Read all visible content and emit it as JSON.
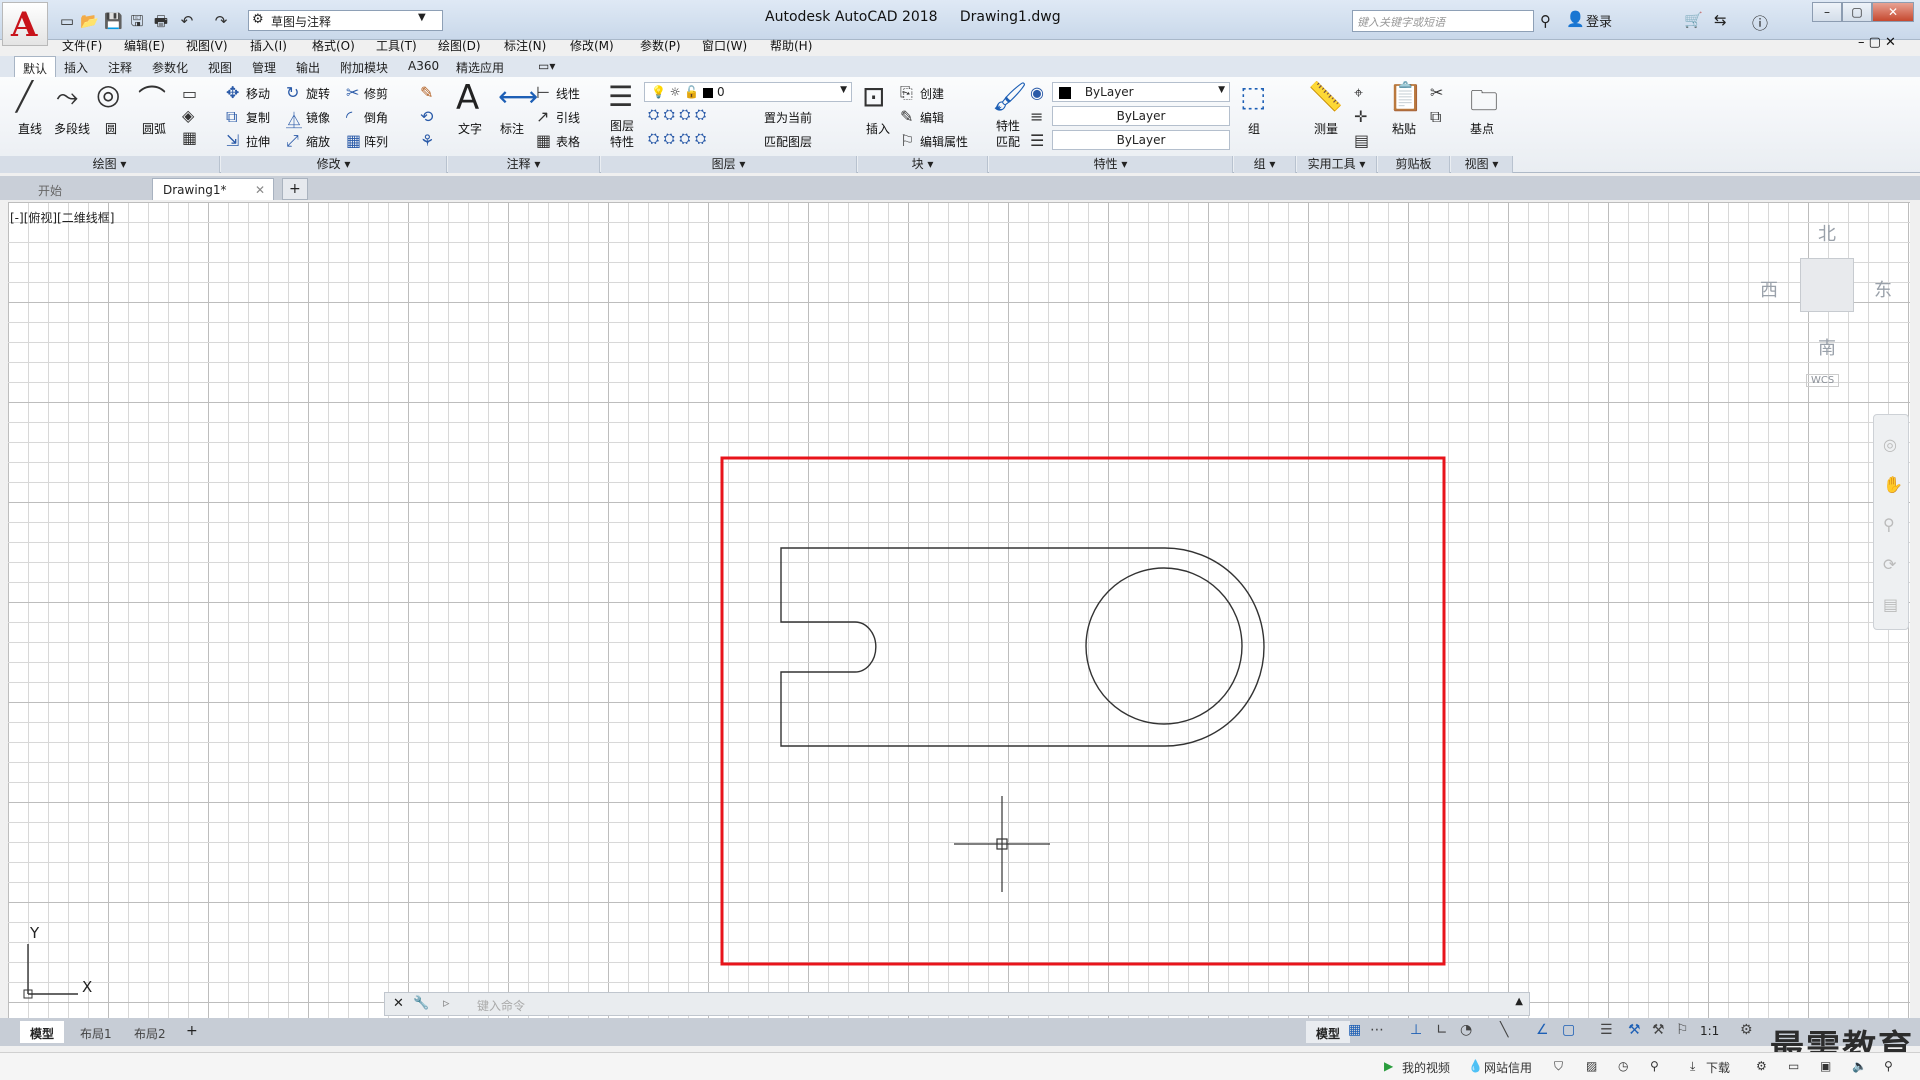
{
  "app": {
    "title": "Autodesk AutoCAD 2018",
    "file": "Drawing1.dwg",
    "workspace": "草图与注释",
    "search_placeholder": "键入关键字或短语",
    "login": "登录"
  },
  "menus": [
    "文件(F)",
    "编辑(E)",
    "视图(V)",
    "插入(I)",
    "格式(O)",
    "工具(T)",
    "绘图(D)",
    "标注(N)",
    "修改(M)",
    "参数(P)",
    "窗口(W)",
    "帮助(H)"
  ],
  "ribbon_tabs": [
    "默认",
    "插入",
    "注释",
    "参数化",
    "视图",
    "管理",
    "输出",
    "附加模块",
    "A360",
    "精选应用"
  ],
  "ribbon": {
    "draw": {
      "title": "绘图",
      "line": "直线",
      "polyline": "多段线",
      "circle": "圆",
      "arc": "圆弧"
    },
    "modify": {
      "title": "修改",
      "move": "移动",
      "rotate": "旋转",
      "trim": "修剪",
      "copy": "复制",
      "mirror": "镜像",
      "fillet": "倒角",
      "stretch": "拉伸",
      "scale": "缩放",
      "array": "阵列"
    },
    "annotation": {
      "title": "注释",
      "text": "文字",
      "dimension": "标注",
      "linear": "线性",
      "leader": "引线",
      "table": "表格"
    },
    "layers": {
      "title": "图层",
      "layer_props": "图层\n特性",
      "layer_name": "0",
      "set_current": "置为当前",
      "match_layer": "匹配图层"
    },
    "block": {
      "title": "块",
      "insert": "插入",
      "create": "创建",
      "edit": "编辑",
      "edit_attr": "编辑属性"
    },
    "properties": {
      "title": "特性",
      "match": "特性\n匹配",
      "color": "ByLayer",
      "linetype": "ByLayer",
      "lineweight": "ByLayer"
    },
    "groups": {
      "title": "组",
      "group": "组"
    },
    "utilities": {
      "title": "实用工具",
      "measure": "测量"
    },
    "clipboard": {
      "title": "剪贴板",
      "paste": "粘贴"
    },
    "view": {
      "title": "视图",
      "base": "基点"
    }
  },
  "doc_tabs": [
    "开始",
    "Drawing1*"
  ],
  "viewport_label": "[-][俯视][二维线框]",
  "viewcube": {
    "north": "北",
    "south": "南",
    "east": "东",
    "west": "西",
    "wcs": "WCS"
  },
  "ucs": {
    "x": "X",
    "y": "Y"
  },
  "command_placeholder": "键入命令",
  "layout_tabs": [
    "模型",
    "布局1",
    "布局2"
  ],
  "status": {
    "model": "模型",
    "scale": "1:1"
  },
  "taskbar": {
    "my_video": "我的视频",
    "net_credit": "网站信用",
    "download": "下载"
  },
  "watermark": "最需教育",
  "colors": {
    "highlight_box": "#e8141b",
    "brand": "#c8141b",
    "grid_minor": "#d8d8d8",
    "grid_major": "#bdbdbd"
  }
}
